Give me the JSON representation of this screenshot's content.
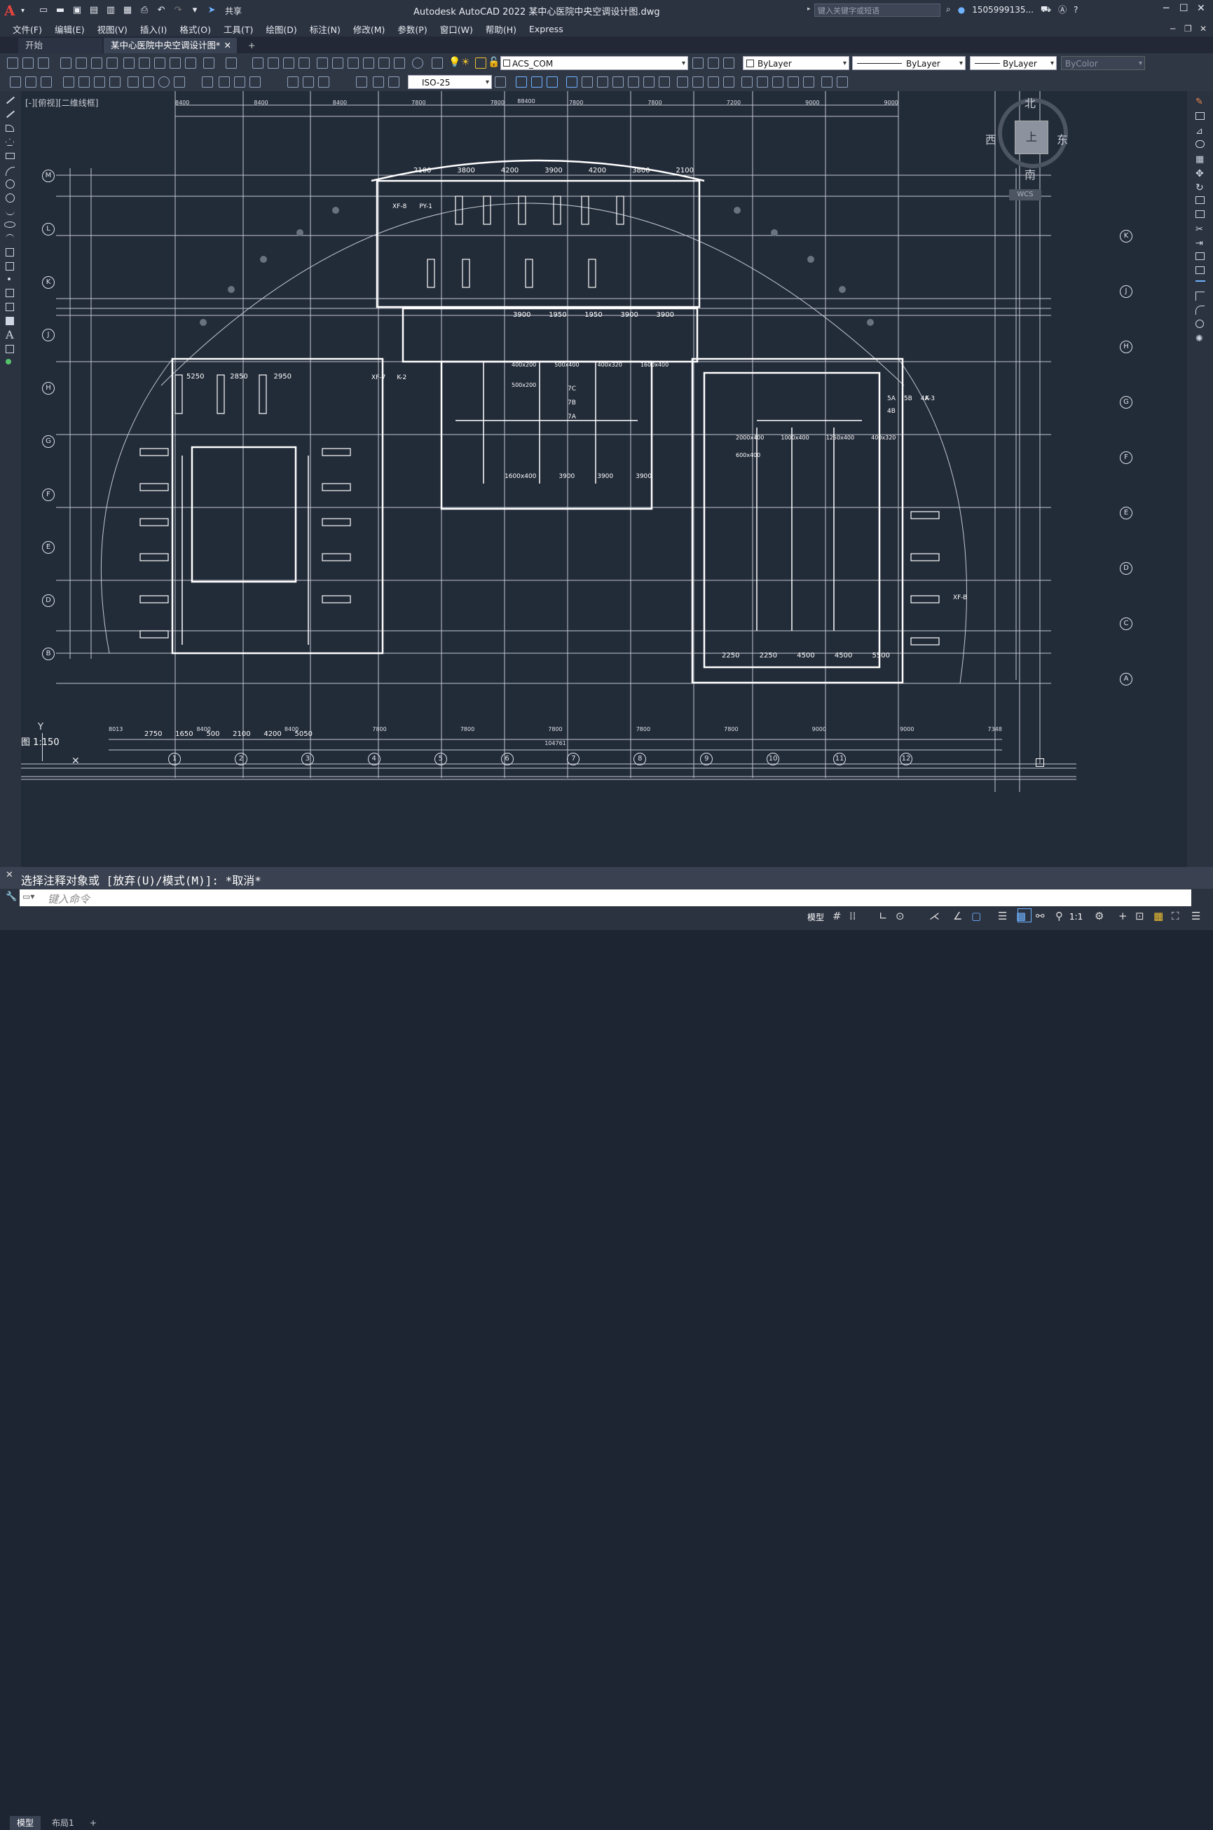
{
  "app": {
    "title": "Autodesk AutoCAD 2022    某中心医院中央空调设计图.dwg",
    "logo": "A",
    "share": "共享",
    "search_placeholder": "键入关键字或短语",
    "user": "1505999135...",
    "qat_icons": [
      "new-icon",
      "open-icon",
      "save-icon",
      "saveas-icon",
      "web-open-icon",
      "web-save-icon",
      "plot-icon",
      "undo-icon",
      "redo-icon"
    ]
  },
  "menu": [
    "文件(F)",
    "编辑(E)",
    "视图(V)",
    "插入(I)",
    "格式(O)",
    "工具(T)",
    "绘图(D)",
    "标注(N)",
    "修改(M)",
    "参数(P)",
    "窗口(W)",
    "帮助(H)",
    "Express"
  ],
  "tabs": [
    {
      "label": "开始",
      "active": false
    },
    {
      "label": "某中心医院中央空调设计图*",
      "active": true
    }
  ],
  "toolbar": {
    "layer": "ACS_COM",
    "color": "ByLayer",
    "linetype": "ByLayer",
    "lineweight": "ByLayer",
    "plotstyle": "ByColor",
    "dimstyle": "ISO-25"
  },
  "viewport": {
    "label": "[-][俯视][二维线框]",
    "viewcube": {
      "n": "北",
      "s": "南",
      "e": "东",
      "w": "西",
      "top": "上",
      "wcs": "WCS"
    },
    "ucs_y": "Y",
    "scale_note": "图 1:150"
  },
  "drawing": {
    "top_dims": [
      "8400",
      "8400",
      "8400",
      "7800",
      "7800",
      "7800",
      "7800",
      "7200",
      "9000",
      "9000"
    ],
    "top_total": "88400",
    "bottom_dims": [
      "8013",
      "8400",
      "8400",
      "7800",
      "7800",
      "7800",
      "7800",
      "7800",
      "9000",
      "9000",
      "7348"
    ],
    "bottom_total": "104761",
    "col_axes": [
      "1",
      "2",
      "3",
      "4",
      "5",
      "6",
      "7",
      "8",
      "9",
      "10",
      "11",
      "12"
    ],
    "row_axes_left": [
      "M",
      "L",
      "K",
      "J",
      "H",
      "G",
      "F",
      "E",
      "D",
      "B"
    ],
    "row_axes_right": [
      "K",
      "J",
      "H",
      "G",
      "F",
      "E",
      "D",
      "C",
      "A"
    ],
    "dims_upper": [
      "2100",
      "3800",
      "4200",
      "3900",
      "4200",
      "3800",
      "2100"
    ],
    "dims_mid": [
      "3900",
      "1950",
      "1950",
      "3900",
      "3900"
    ],
    "dims_left": [
      "5250",
      "2850",
      "2950"
    ],
    "dims_bottom_left": [
      "2750",
      "1650",
      "500",
      "2100",
      "4200",
      "5050"
    ],
    "dims_bottom_mid": [
      "1600x400",
      "3900",
      "3900",
      "3900"
    ],
    "dims_bottom_right": [
      "2250",
      "2250",
      "4500",
      "4500",
      "5500"
    ],
    "ducts": [
      "400x200",
      "500x400",
      "400x320",
      "1600x400",
      "500x200",
      "2000x400",
      "1000x400",
      "1250x400",
      "400x320",
      "600x400"
    ],
    "labels": [
      "XF-8",
      "PY-1",
      "XF-7",
      "K-2",
      "K-3",
      "XF-B",
      "7C",
      "7B",
      "7A",
      "5A",
      "5B",
      "4A",
      "4B"
    ]
  },
  "command": {
    "history": "选择注释对象或 [放弃(U)/模式(M)]: *取消*",
    "placeholder": "键入命令"
  },
  "status": {
    "tabs": [
      "模型",
      "布局1"
    ],
    "model_btn": "模型",
    "scale": "1:1"
  }
}
